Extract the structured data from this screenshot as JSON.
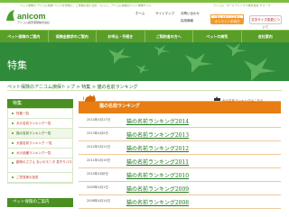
{
  "header": {
    "tagline": "ペット保険の アニコム損保 ペットを家族に、ご家族の思い出を、もっと。アニコム損保のペット保険サイト",
    "tagline_right": "アニコム・ホールディングス株式会社 グループ",
    "logo_brand": "anicom",
    "logo_sub": "アニコム損害保険株式会社",
    "links": [
      "ホーム",
      "サイトマップ",
      "お問い合わせ",
      "採用情報"
    ],
    "badge_top": "ご加入されている方へ",
    "badge_bottom": "オンライン手続き",
    "login_label": "文字サイズ変更について"
  },
  "nav": {
    "items": [
      "ペット保険のご案内",
      "保険金請求のご案内",
      "お申込・手続き",
      "ご契約者の方へ",
      "ペットの病気",
      "会社案内"
    ]
  },
  "hero": {
    "title": "特集"
  },
  "breadcrumb": "ペット保険のアニコム損保トップ > 特集 > 猫の名前ランキング",
  "sidebar": {
    "head": "特集",
    "items": [
      "特集一覧",
      "犬の名前ランキング一覧",
      "猫の名前ランキング一覧",
      "犬猫名前ランキング 一覧",
      "犬の品種ランキング一覧",
      "動物のささえ あいのモニタ 見守りパネル",
      "ご意見等の投書"
    ],
    "head2": "ペット保険のご案内"
  },
  "ranking": {
    "header": "猫の名前ランキング",
    "dog_link": "犬の名前ランキングはこちら",
    "rows": [
      {
        "date": "2014年4月17日",
        "title": "猫の名前ランキング2014"
      },
      {
        "date": "2013年4月9日",
        "title": "猫の名前ランキング2013"
      },
      {
        "date": "2012年4月11日",
        "title": "猫の名前ランキング2012"
      },
      {
        "date": "2011年4月19日",
        "title": "猫の名前ランキング2011"
      },
      {
        "date": "2010年4月8日",
        "title": "猫の名前ランキング2010"
      },
      {
        "date": "2009年4月1日",
        "title": "猫の名前ランキング2009"
      },
      {
        "date": "2008年4月14日",
        "title": "猫の名前ランキング2008"
      }
    ]
  },
  "colors": {
    "nav_green": "#5a9e2a",
    "hero_green": "#2f8a3a",
    "accent_orange": "#e77d13",
    "link_green": "#1f7a1f"
  }
}
